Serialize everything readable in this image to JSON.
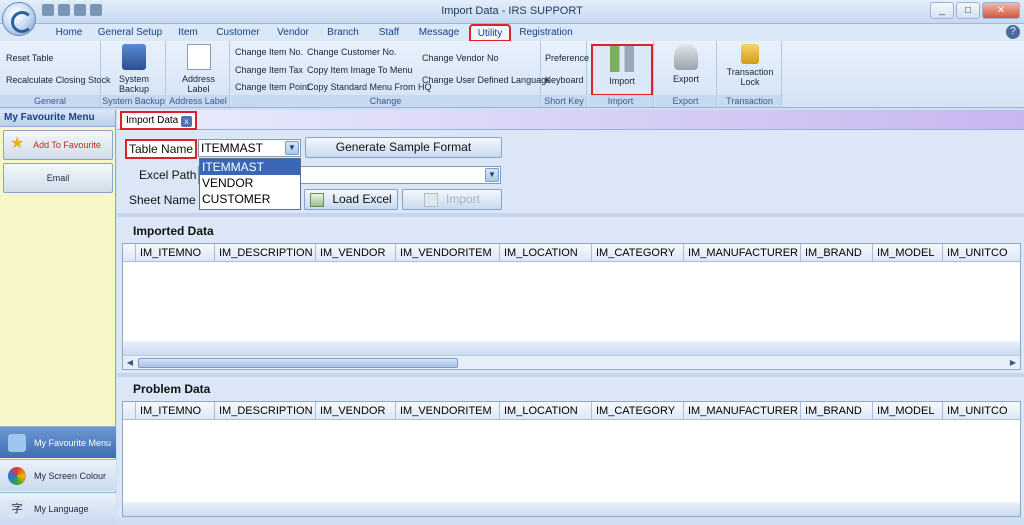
{
  "window": {
    "title": "Import Data - IRS SUPPORT",
    "controls": [
      "_",
      "□",
      "✕"
    ]
  },
  "ribbon_tabs": [
    "Home",
    "General Setup",
    "Item",
    "Customer",
    "Vendor",
    "Branch",
    "Staff",
    "Message",
    "Utility",
    "Registration"
  ],
  "ribbon": {
    "general": {
      "items": [
        "Reset Table",
        "Recalculate Closing Stock"
      ],
      "label": "General"
    },
    "system_backup": {
      "button": "System Backup",
      "label": "System Backup"
    },
    "address_label": {
      "button": "Address Label",
      "label": "Address Label"
    },
    "change": {
      "items": [
        "Change Item No.",
        "Change Item Tax",
        "Change Item Point",
        "Change Customer No.",
        "Copy Item Image To Menu",
        "Copy Standard Menu From HQ",
        "Change Vendor No",
        "Change User Defined Language"
      ],
      "label": "Change"
    },
    "short_key": {
      "items": [
        "Preference",
        "Keyboard"
      ],
      "label": "Short Key"
    },
    "import": {
      "button": "Import",
      "label": "Import"
    },
    "export": {
      "button": "Export",
      "label": "Export"
    },
    "transaction": {
      "button": "Transaction Lock",
      "label": "Transaction"
    }
  },
  "sidebar": {
    "header": "My Favourite Menu",
    "add_favourite": "Add To Favourite",
    "email": "Email",
    "bottom_items": [
      "My Favourite Menu",
      "My Screen Colour",
      "My Language"
    ]
  },
  "doc_tab": {
    "label": "Import Data",
    "close": "x"
  },
  "form": {
    "table_name_label": "Table Name",
    "table_name_value": "ITEMMAST",
    "table_options": [
      "ITEMMAST",
      "VENDOR",
      "CUSTOMER"
    ],
    "excel_path_label": "Excel Path",
    "excel_path_value": "",
    "sheet_name_label": "Sheet Name",
    "generate_button": "Generate Sample Format",
    "load_excel_button": "Load Excel",
    "import_button": "Import"
  },
  "imported": {
    "title": "Imported Data",
    "columns": [
      "IM_ITEMNO",
      "IM_DESCRIPTION",
      "IM_VENDOR",
      "IM_VENDORITEM",
      "IM_LOCATION",
      "IM_CATEGORY",
      "IM_MANUFACTURER",
      "IM_BRAND",
      "IM_MODEL",
      "IM_UNITCO"
    ]
  },
  "problem": {
    "title": "Problem Data",
    "columns": [
      "IM_ITEMNO",
      "IM_DESCRIPTION",
      "IM_VENDOR",
      "IM_VENDORITEM",
      "IM_LOCATION",
      "IM_CATEGORY",
      "IM_MANUFACTURER",
      "IM_BRAND",
      "IM_MODEL",
      "IM_UNITCO"
    ]
  },
  "accent_color": "#e01f26"
}
